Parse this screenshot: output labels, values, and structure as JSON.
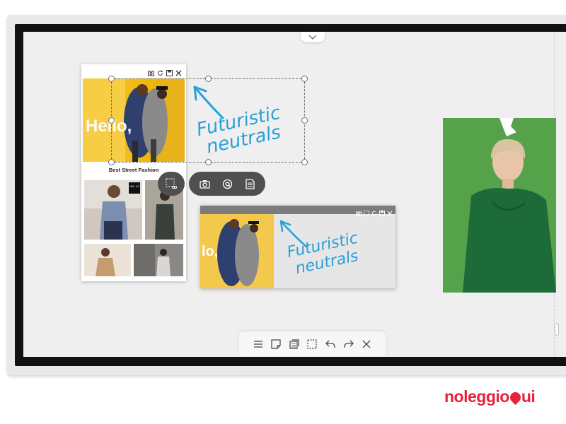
{
  "annotation": {
    "line1": "Futuristic",
    "line2": "neutrals"
  },
  "doc": {
    "hero_text": "Hello,",
    "title": "Best Street Fashion",
    "tile_badge": "HEL LO",
    "footer": ""
  },
  "capture": {
    "hero_text": "lo,"
  },
  "brand": {
    "name_before": "noleggio",
    "name_after": "ui"
  },
  "colors": {
    "accent_annotation": "#2aa0d8",
    "brand": "#e8223a",
    "toolbar_dark": "#4f4f4f",
    "green_bg": "#54a148"
  },
  "icons": {
    "doc_window": [
      "camera-icon",
      "refresh-icon",
      "save-icon",
      "close-icon"
    ],
    "float_toolbar": [
      "crop-cut-icon",
      "camera-icon",
      "email-icon",
      "document-icon"
    ],
    "capture_window": [
      "camera-icon",
      "crop-icon",
      "refresh-icon",
      "save-icon",
      "close-icon"
    ],
    "bottom_toolbar": [
      "menu-icon",
      "sticky-note-icon",
      "import-icon",
      "select-icon",
      "undo-icon",
      "redo-icon",
      "close-icon"
    ]
  }
}
